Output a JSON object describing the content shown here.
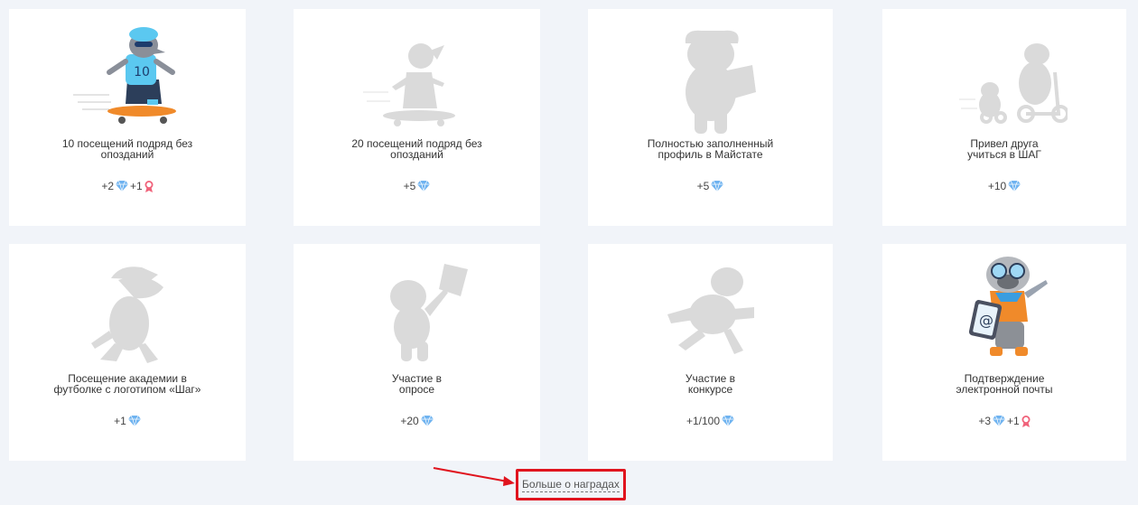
{
  "achievements": [
    {
      "title_line1": "10 посещений подряд без",
      "title_line2": "опозданий",
      "reward_gems": "+2",
      "reward_ribbon": "+1",
      "unlocked": true,
      "image": "rat-skateboarder-color"
    },
    {
      "title_line1": "20 посещений подряд без",
      "title_line2": "опозданий",
      "reward_gems": "+5",
      "unlocked": false,
      "image": "skateboarder-silhouette"
    },
    {
      "title_line1": "Полностью заполненный",
      "title_line2": "профиль в Майстате",
      "reward_gems": "+5",
      "unlocked": false,
      "image": "dog-with-paper-silhouette"
    },
    {
      "title_line1": "Привел друга",
      "title_line2": "учиться в ШАГ",
      "reward_gems": "+10",
      "unlocked": false,
      "image": "bear-scooter-silhouette"
    },
    {
      "title_line1": "Посещение академии в",
      "title_line2": "футболке с логотипом «Шаг»",
      "reward_gems": "+1",
      "unlocked": false,
      "image": "dino-cap-silhouette"
    },
    {
      "title_line1": "Участие в",
      "title_line2": "опросе",
      "reward_gems": "+20",
      "unlocked": false,
      "image": "character-with-sign-silhouette"
    },
    {
      "title_line1": "Участие в",
      "title_line2": "конкурсе",
      "reward_gems": "+1/100",
      "unlocked": false,
      "image": "running-bear-silhouette"
    },
    {
      "title_line1": "Подтверждение",
      "title_line2": "электронной почты",
      "reward_gems": "+3",
      "reward_ribbon": "+1",
      "unlocked": true,
      "image": "pug-with-tablet-color"
    }
  ],
  "more_link": "Больше о наградах",
  "colors": {
    "gem": "#6fb3f0",
    "ribbon": "#f0627a",
    "silhouette": "#dadada",
    "highlight": "#e0141e"
  }
}
